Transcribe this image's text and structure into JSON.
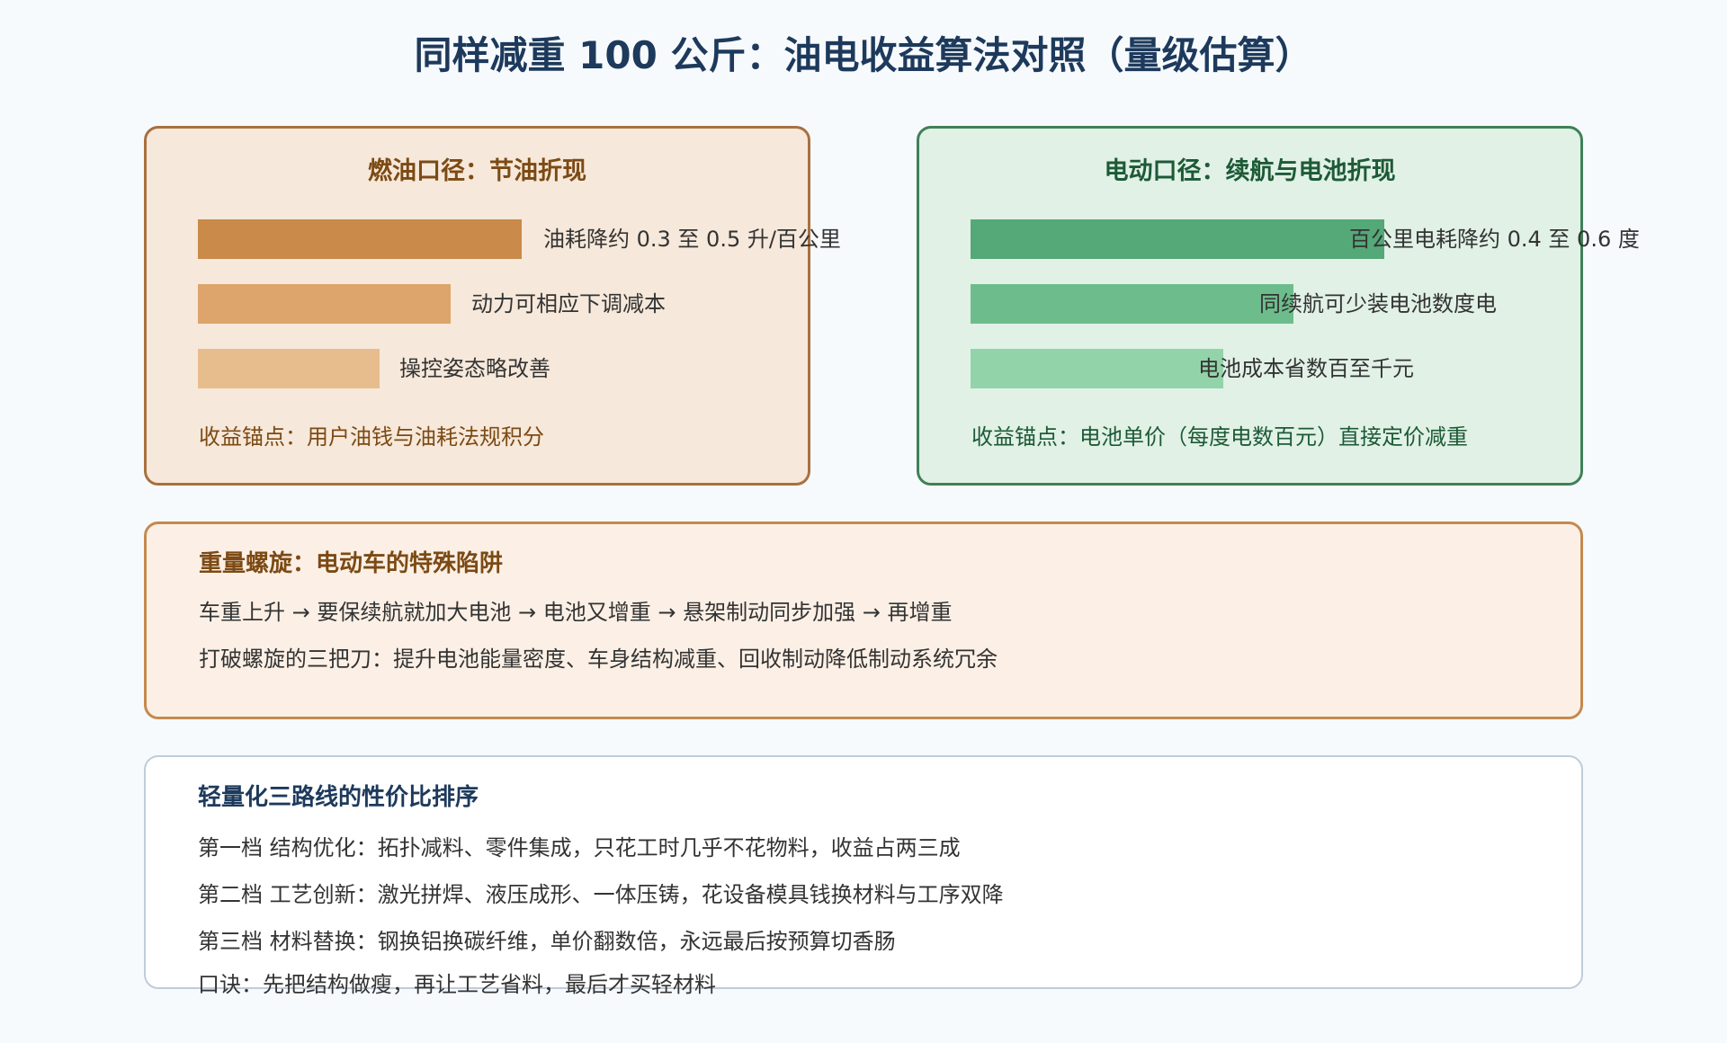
{
  "title": "同样减重 100 公斤：油电收益算法对照（量级估算）",
  "fuel": {
    "title": "燃油口径：节油折现",
    "bars": [
      {
        "label": "油耗降约 0.3 至 0.5 升/百公里",
        "level": 1.0,
        "color": "#c98a4a"
      },
      {
        "label": "动力可相应下调减本",
        "level": 0.78,
        "color": "#dda56b"
      },
      {
        "label": "操控姿态略改善",
        "level": 0.56,
        "color": "#e8bd8d"
      }
    ],
    "anchor": "收益锚点：用户油钱与油耗法规积分"
  },
  "ev": {
    "title": "电动口径：续航与电池折现",
    "bars": [
      {
        "label": "百公里电耗降约 0.4 至 0.6 度",
        "level": 1.0,
        "color": "#55a878"
      },
      {
        "label": "同续航可少装电池数度电",
        "level": 0.78,
        "color": "#6dbd8c"
      },
      {
        "label": "电池成本省数百至千元",
        "level": 0.61,
        "color": "#93d3a9"
      }
    ],
    "anchor": "收益锚点：电池单价（每度电数百元）直接定价减重"
  },
  "spiral": {
    "title": "重量螺旋：电动车的特殊陷阱",
    "lines": [
      "车重上升 → 要保续航就加大电池 → 电池又增重 → 悬架制动同步加强 → 再增重",
      "打破螺旋的三把刀：提升电池能量密度、车身结构减重、回收制动降低制动系统冗余"
    ]
  },
  "routes": {
    "title": "轻量化三路线的性价比排序",
    "lines": [
      "第一档 结构优化：拓扑减料、零件集成，只花工时几乎不花物料，收益占两三成",
      "第二档 工艺创新：激光拼焊、液压成形、一体压铸，花设备模具钱换材料与工序双降",
      "第三档 材料替换：钢换铝换碳纤维，单价翻数倍，永远最后按预算切香肠",
      "口诀：先把结构做瘦，再让工艺省料，最后才买轻材料"
    ]
  }
}
